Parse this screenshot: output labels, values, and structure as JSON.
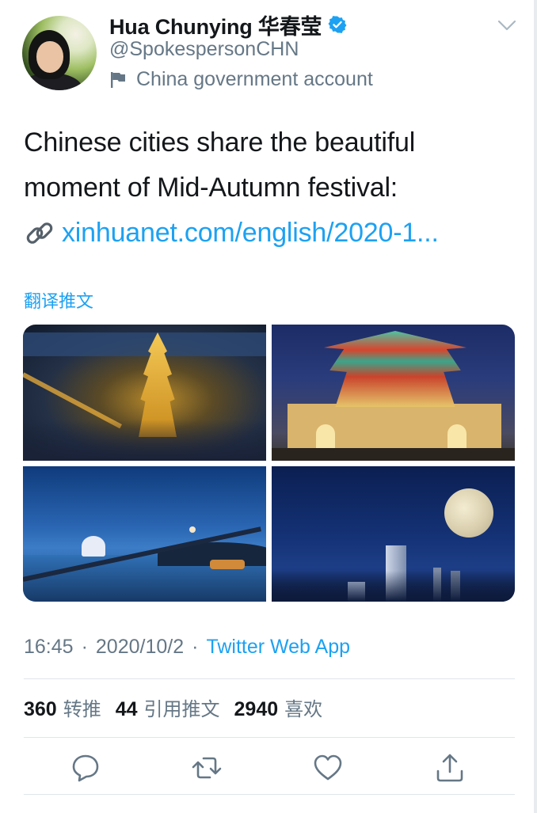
{
  "author": {
    "display_name": "Hua Chunying 华春莹",
    "handle": "@SpokespersonCHN",
    "account_label": "China government account"
  },
  "tweet": {
    "text_line_1": "Chinese cities share the beautiful",
    "text_line_2": "moment of Mid-Autumn festival:",
    "link_text": "xinhuanet.com/english/2020-1...",
    "translate_label": "翻译推文"
  },
  "media": [
    {
      "name": "Yellow Crane Tower at night"
    },
    {
      "name": "Bell Tower at night"
    },
    {
      "name": "Bay with moon"
    },
    {
      "name": "Full moon over skyline"
    }
  ],
  "meta": {
    "time": "16:45",
    "separator": "·",
    "date": "2020/10/2",
    "source": "Twitter Web App"
  },
  "stats": {
    "retweets": "360",
    "retweets_label": "转推",
    "quotes": "44",
    "quotes_label": "引用推文",
    "likes": "2940",
    "likes_label": "喜欢"
  },
  "icons": {
    "verified": "verified-badge-icon",
    "flag": "flag-icon",
    "chevron": "chevron-down-icon",
    "link": "link-icon",
    "reply": "reply-icon",
    "retweet": "retweet-icon",
    "like": "heart-icon",
    "share": "share-icon"
  },
  "colors": {
    "accent": "#1da1f2",
    "secondary_text": "#657786",
    "primary_text": "#14171a",
    "divider": "#dfe5ea"
  }
}
